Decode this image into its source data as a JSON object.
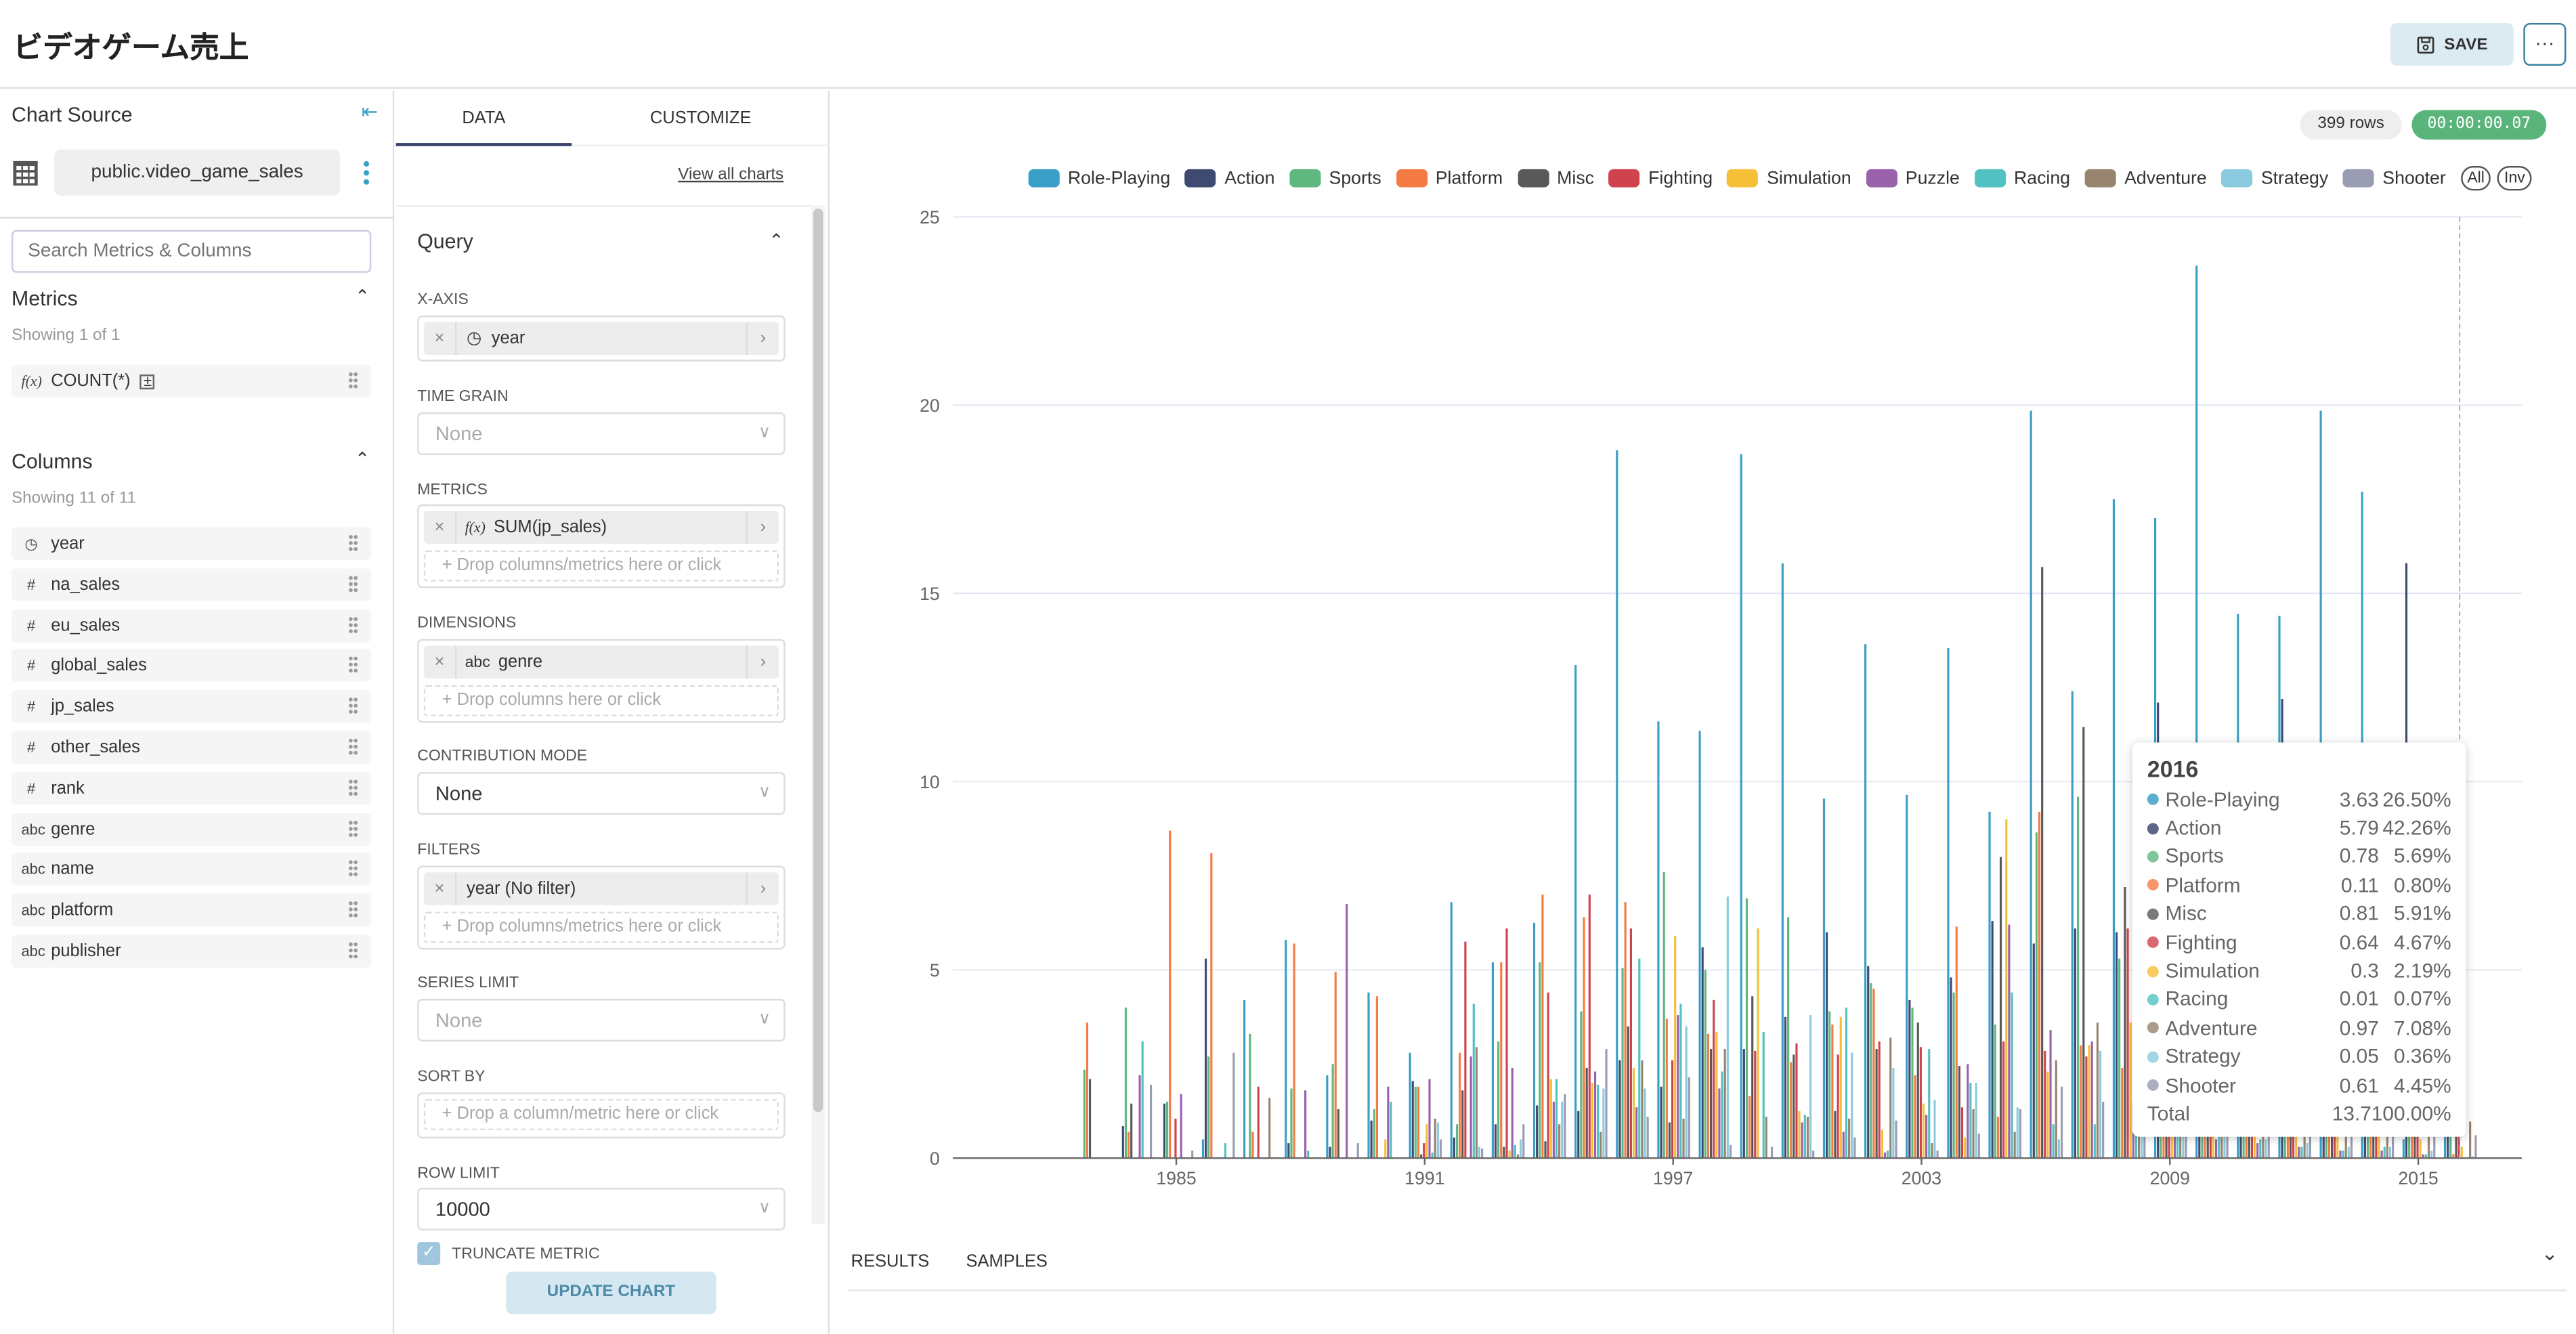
{
  "header": {
    "title": "ビデオゲーム売上",
    "save_label": "SAVE",
    "more_label": "···"
  },
  "left": {
    "chart_source": "Chart Source",
    "dataset": "public.video_game_sales",
    "search_placeholder": "Search Metrics & Columns",
    "metrics_title": "Metrics",
    "metrics_count": "Showing 1 of 1",
    "metrics": [
      {
        "icon": "f(x)",
        "label": "COUNT(*)"
      }
    ],
    "columns_title": "Columns",
    "columns_count": "Showing 11 of 11",
    "columns": [
      {
        "icon": "clock",
        "label": "year"
      },
      {
        "icon": "#",
        "label": "na_sales"
      },
      {
        "icon": "#",
        "label": "eu_sales"
      },
      {
        "icon": "#",
        "label": "global_sales"
      },
      {
        "icon": "#",
        "label": "jp_sales"
      },
      {
        "icon": "#",
        "label": "other_sales"
      },
      {
        "icon": "#",
        "label": "rank"
      },
      {
        "icon": "abc",
        "label": "genre"
      },
      {
        "icon": "abc",
        "label": "name"
      },
      {
        "icon": "abc",
        "label": "platform"
      },
      {
        "icon": "abc",
        "label": "publisher"
      }
    ]
  },
  "middle": {
    "tabs": [
      "DATA",
      "CUSTOMIZE"
    ],
    "view_all": "View all charts",
    "query": "Query",
    "x_axis": {
      "label": "X-AXIS",
      "value": "year"
    },
    "time_grain": {
      "label": "TIME GRAIN",
      "placeholder": "None"
    },
    "metrics": {
      "label": "METRICS",
      "fx": "f(x)",
      "value": "SUM(jp_sales)",
      "drop": "Drop columns/metrics here or click"
    },
    "dimensions": {
      "label": "DIMENSIONS",
      "type": "abc",
      "value": "genre",
      "drop": "Drop columns here or click"
    },
    "contribution": {
      "label": "CONTRIBUTION MODE",
      "value": "None"
    },
    "filters": {
      "label": "FILTERS",
      "value": "year (No filter)",
      "drop": "Drop columns/metrics here or click"
    },
    "series_limit": {
      "label": "SERIES LIMIT",
      "placeholder": "None"
    },
    "sort_by": {
      "label": "SORT BY",
      "drop": "Drop a column/metric here or click"
    },
    "row_limit": {
      "label": "ROW LIMIT",
      "value": "10000"
    },
    "truncate": {
      "label": "TRUNCATE METRIC",
      "checked": true
    },
    "update": "UPDATE CHART"
  },
  "status": {
    "rows": "399 rows",
    "timer": "00:00:00.07"
  },
  "legend_buttons": [
    "All",
    "Inv"
  ],
  "bottom": {
    "results": "RESULTS",
    "samples": "SAMPLES"
  },
  "tooltip": {
    "year": "2016",
    "rows": [
      {
        "name": "Role-Playing",
        "value": "3.63",
        "pct": "26.50%",
        "color": "#5aaed0"
      },
      {
        "name": "Action",
        "value": "5.79",
        "pct": "42.26%",
        "color": "#5d6688"
      },
      {
        "name": "Sports",
        "value": "0.78",
        "pct": "5.69%",
        "color": "#7fc79a"
      },
      {
        "name": "Platform",
        "value": "0.11",
        "pct": "0.80%",
        "color": "#f6966a"
      },
      {
        "name": "Misc",
        "value": "0.81",
        "pct": "5.91%",
        "color": "#7a7a7a"
      },
      {
        "name": "Fighting",
        "value": "0.64",
        "pct": "4.67%",
        "color": "#d96870"
      },
      {
        "name": "Simulation",
        "value": "0.3",
        "pct": "2.19%",
        "color": "#f8cc5f"
      },
      {
        "name": "Racing",
        "value": "0.01",
        "pct": "0.07%",
        "color": "#75cfcf"
      },
      {
        "name": "Adventure",
        "value": "0.97",
        "pct": "7.08%",
        "color": "#ab9d8c"
      },
      {
        "name": "Strategy",
        "value": "0.05",
        "pct": "0.36%",
        "color": "#a3d5e5"
      },
      {
        "name": "Shooter",
        "value": "0.61",
        "pct": "4.45%",
        "color": "#acafc2"
      }
    ],
    "total_label": "Total",
    "total_value": "13.7",
    "total_pct": "100.00%"
  },
  "chart_data": {
    "type": "bar",
    "ylim": [
      0,
      25
    ],
    "yticks": [
      0,
      5,
      10,
      15,
      20,
      25
    ],
    "xticks": [
      1985,
      1991,
      1997,
      2003,
      2009,
      2015
    ],
    "grid": true,
    "legend": "top-right",
    "series": [
      {
        "name": "Role-Playing",
        "color": "#3a9fc6"
      },
      {
        "name": "Action",
        "color": "#3e4a72"
      },
      {
        "name": "Sports",
        "color": "#5fb87f"
      },
      {
        "name": "Platform",
        "color": "#f47c44"
      },
      {
        "name": "Misc",
        "color": "#595959"
      },
      {
        "name": "Fighting",
        "color": "#d0434e"
      },
      {
        "name": "Simulation",
        "color": "#f6bf38"
      },
      {
        "name": "Puzzle",
        "color": "#9a62ab"
      },
      {
        "name": "Racing",
        "color": "#52c1c2"
      },
      {
        "name": "Adventure",
        "color": "#978570"
      },
      {
        "name": "Strategy",
        "color": "#8ccbdf"
      },
      {
        "name": "Shooter",
        "color": "#999cb3"
      }
    ],
    "data": [
      {
        "year": 1983,
        "values": [
          0,
          0,
          2.35,
          3.6,
          2.1,
          0,
          0,
          0,
          0,
          0,
          0,
          0
        ]
      },
      {
        "year": 1984,
        "values": [
          0,
          0.85,
          4.0,
          0.7,
          1.45,
          0,
          0,
          2.2,
          3.1,
          0,
          0,
          1.95
        ]
      },
      {
        "year": 1985,
        "values": [
          0,
          1.45,
          1.5,
          8.7,
          0,
          1.05,
          0,
          1.7,
          0,
          0,
          0,
          0.2
        ]
      },
      {
        "year": 1986,
        "values": [
          0.5,
          5.3,
          2.7,
          8.1,
          0,
          0,
          0,
          0,
          0.4,
          0,
          0,
          2.8
        ]
      },
      {
        "year": 1987,
        "values": [
          4.2,
          0,
          3.3,
          0.7,
          0,
          1.9,
          0,
          0,
          0,
          1.6,
          0,
          0
        ]
      },
      {
        "year": 1988,
        "values": [
          5.8,
          0.4,
          1.85,
          5.7,
          0,
          0,
          0,
          1.8,
          0.2,
          0,
          0,
          0
        ]
      },
      {
        "year": 1989,
        "values": [
          2.2,
          0.3,
          2.5,
          4.95,
          1.3,
          0,
          0,
          6.75,
          0,
          0,
          0,
          0.4
        ]
      },
      {
        "year": 1990,
        "values": [
          4.4,
          1.0,
          1.3,
          4.3,
          0,
          0,
          0.5,
          1.9,
          1.5,
          0,
          0,
          0
        ]
      },
      {
        "year": 1991,
        "values": [
          2.8,
          2.05,
          1.9,
          1.9,
          0.1,
          0.4,
          0.9,
          2.1,
          0.15,
          1.05,
          0.95,
          0.5
        ]
      },
      {
        "year": 1992,
        "values": [
          6.8,
          0.55,
          0.9,
          2.8,
          1.8,
          5.75,
          0,
          2.7,
          4.1,
          2.95,
          0.3,
          0.25
        ]
      },
      {
        "year": 1993,
        "values": [
          5.2,
          0.9,
          3.1,
          5.2,
          0.3,
          6.1,
          0.2,
          2.4,
          0.35,
          0.1,
          0.5,
          0.9
        ]
      },
      {
        "year": 1994,
        "values": [
          6.25,
          1.4,
          5.2,
          7.0,
          0.45,
          4.4,
          2.1,
          1.5,
          2.1,
          0.9,
          1.5,
          1.7
        ]
      },
      {
        "year": 1995,
        "values": [
          13.1,
          1.25,
          3.9,
          6.4,
          2.4,
          7.0,
          2.0,
          2.3,
          1.95,
          0.7,
          1.85,
          2.9
        ]
      },
      {
        "year": 1996,
        "values": [
          18.8,
          2.6,
          5.05,
          6.8,
          3.5,
          6.1,
          2.4,
          1.35,
          5.3,
          2.6,
          1.85,
          1.1
        ]
      },
      {
        "year": 1997,
        "values": [
          11.6,
          1.9,
          7.6,
          3.7,
          0.95,
          2.6,
          5.9,
          3.8,
          4.1,
          1.05,
          3.5,
          2.15
        ]
      },
      {
        "year": 1998,
        "values": [
          11.35,
          5.6,
          5.0,
          3.3,
          2.9,
          4.2,
          3.35,
          1.85,
          2.3,
          2.9,
          6.95,
          0.35
        ]
      },
      {
        "year": 1999,
        "values": [
          18.7,
          2.9,
          6.9,
          1.65,
          4.3,
          2.85,
          6.1,
          0,
          3.35,
          1.1,
          0,
          0.3
        ]
      },
      {
        "year": 2000,
        "values": [
          15.8,
          3.75,
          6.4,
          2.55,
          2.75,
          3.05,
          1.25,
          0.95,
          1.15,
          1.1,
          3.8,
          0.2
        ]
      },
      {
        "year": 2001,
        "values": [
          9.55,
          6.0,
          3.9,
          3.55,
          1.25,
          2.75,
          3.75,
          0.7,
          4.0,
          1.05,
          2.8,
          0.55
        ]
      },
      {
        "year": 2002,
        "values": [
          13.65,
          5.1,
          4.65,
          4.5,
          2.9,
          3.1,
          0.75,
          0.15,
          0.2,
          3.2,
          2.4,
          1.0
        ]
      },
      {
        "year": 2003,
        "values": [
          9.65,
          4.2,
          4.0,
          2.2,
          3.6,
          2.95,
          1.45,
          1.15,
          2.9,
          0.4,
          1.55,
          0.2
        ]
      },
      {
        "year": 2004,
        "values": [
          13.55,
          4.8,
          4.4,
          6.15,
          2.45,
          1.35,
          0.55,
          2.5,
          2.0,
          1.3,
          2.0,
          0.65
        ]
      },
      {
        "year": 2005,
        "values": [
          9.2,
          6.3,
          3.55,
          1.1,
          8.0,
          3.1,
          9.0,
          6.2,
          4.4,
          0.7,
          1.35,
          1.3
        ]
      },
      {
        "year": 2006,
        "values": [
          19.85,
          5.7,
          8.65,
          9.2,
          15.7,
          2.85,
          2.3,
          3.4,
          0.9,
          2.6,
          0.5,
          1.9
        ]
      },
      {
        "year": 2007,
        "values": [
          12.4,
          6.1,
          9.6,
          3.0,
          11.45,
          2.7,
          3.0,
          3.1,
          0.9,
          3.6,
          2.85,
          1.5
        ]
      },
      {
        "year": 2008,
        "values": [
          17.5,
          6.0,
          5.3,
          2.4,
          7.2,
          6.1,
          3.6,
          1.5,
          0.8,
          1.4,
          0.9,
          0.8
        ]
      },
      {
        "year": 2009,
        "values": [
          17.0,
          12.1,
          4.5,
          2.2,
          4.5,
          1.8,
          1.6,
          1.0,
          0.9,
          1.5,
          0.8,
          1.0
        ]
      },
      {
        "year": 2010,
        "values": [
          23.7,
          4.5,
          3.0,
          2.6,
          3.5,
          1.5,
          1.6,
          0.5,
          0.6,
          1.8,
          0.6,
          1.0
        ]
      },
      {
        "year": 2011,
        "values": [
          14.45,
          4.5,
          2.5,
          1.9,
          2.5,
          2.0,
          1.2,
          0.4,
          0.5,
          1.4,
          0.5,
          1.2
        ]
      },
      {
        "year": 2012,
        "values": [
          14.4,
          12.2,
          1.8,
          1.6,
          2.0,
          1.1,
          1.0,
          0.3,
          0.3,
          1.2,
          0.4,
          1.3
        ]
      },
      {
        "year": 2013,
        "values": [
          19.85,
          6.0,
          1.5,
          2.5,
          1.8,
          1.5,
          1.0,
          0.2,
          0.2,
          1.5,
          0.3,
          1.5
        ]
      },
      {
        "year": 2014,
        "values": [
          17.7,
          6.5,
          1.3,
          1.2,
          2.2,
          2.0,
          0.8,
          0.2,
          0.3,
          1.3,
          0.3,
          1.6
        ]
      },
      {
        "year": 2015,
        "values": [
          0.5,
          15.8,
          1.0,
          0.6,
          1.5,
          1.1,
          0.5,
          0.1,
          0.1,
          1.2,
          0.2,
          1.4
        ]
      },
      {
        "year": 2016,
        "values": [
          3.63,
          5.79,
          0.78,
          0.11,
          0.81,
          0.64,
          0.3,
          0,
          0.01,
          0.97,
          0.05,
          0.61
        ]
      }
    ]
  }
}
